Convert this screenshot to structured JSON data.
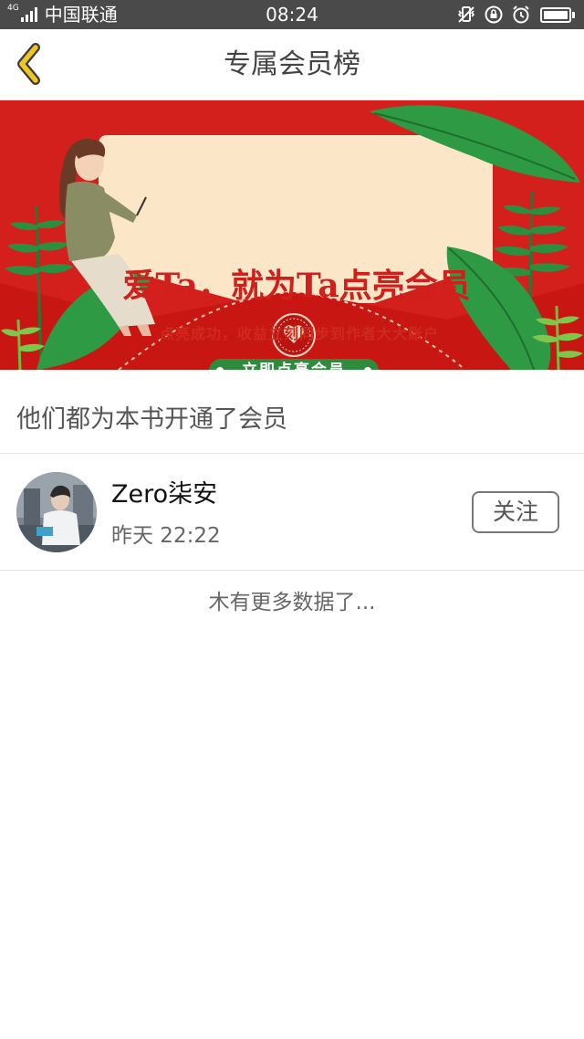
{
  "status_bar": {
    "network_type": "4G",
    "carrier": "中国联通",
    "time": "08:24",
    "icons": [
      "signal-icon",
      "vibrate-icon",
      "rotation-lock-icon",
      "alarm-icon",
      "battery-icon"
    ],
    "battery_level": 1.0
  },
  "nav": {
    "back_icon": "chevron-left-icon",
    "title": "专属会员榜",
    "accent_color": "#e8c21c"
  },
  "banner": {
    "headline": "爱Ta，就为Ta点亮会员",
    "subtitle": "点亮成功，收益立刻同步到作者大大账户",
    "cta_label": "立即点亮会员",
    "colors": {
      "background": "#d4201c",
      "card": "#fbe6c8",
      "cta": "#2e8b3e",
      "leaf": "#2f9a44"
    }
  },
  "section": {
    "title": "他们都为本书开通了会员"
  },
  "members": [
    {
      "name": "Zero柒安",
      "time": "昨天 22:22",
      "follow_label": "关注",
      "avatar_icon": "user-avatar"
    }
  ],
  "footer": {
    "no_more_text": "木有更多数据了..."
  }
}
